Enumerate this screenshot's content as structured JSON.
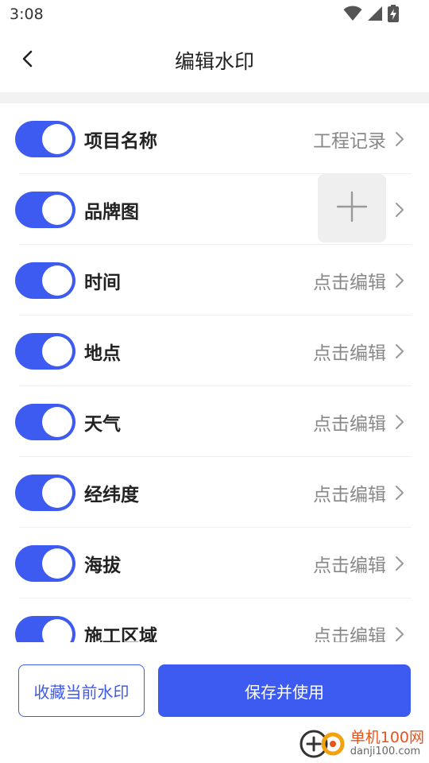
{
  "status_bar": {
    "time": "3:08",
    "icons": [
      "wifi-icon",
      "signal-icon",
      "battery-charging-icon"
    ]
  },
  "header": {
    "title": "编辑水印",
    "back_icon": "chevron-left-icon"
  },
  "items": [
    {
      "label": "项目名称",
      "value": "工程记录",
      "enabled": true,
      "type": "text"
    },
    {
      "label": "品牌图",
      "value": "",
      "enabled": true,
      "type": "image"
    },
    {
      "label": "时间",
      "value": "点击编辑",
      "enabled": true,
      "type": "text"
    },
    {
      "label": "地点",
      "value": "点击编辑",
      "enabled": true,
      "type": "text"
    },
    {
      "label": "天气",
      "value": "点击编辑",
      "enabled": true,
      "type": "text"
    },
    {
      "label": "经纬度",
      "value": "点击编辑",
      "enabled": true,
      "type": "text"
    },
    {
      "label": "海拔",
      "value": "点击编辑",
      "enabled": true,
      "type": "text"
    },
    {
      "label": "施工区域",
      "value": "点击编辑",
      "enabled": true,
      "type": "text"
    }
  ],
  "buttons": {
    "favorite": "收藏当前水印",
    "save": "保存并使用"
  },
  "watermark": {
    "main": "单机100网",
    "sub": "danji100.com"
  },
  "colors": {
    "accent": "#3d5af1",
    "muted_text": "#888888",
    "divider": "#f0f0f0"
  }
}
